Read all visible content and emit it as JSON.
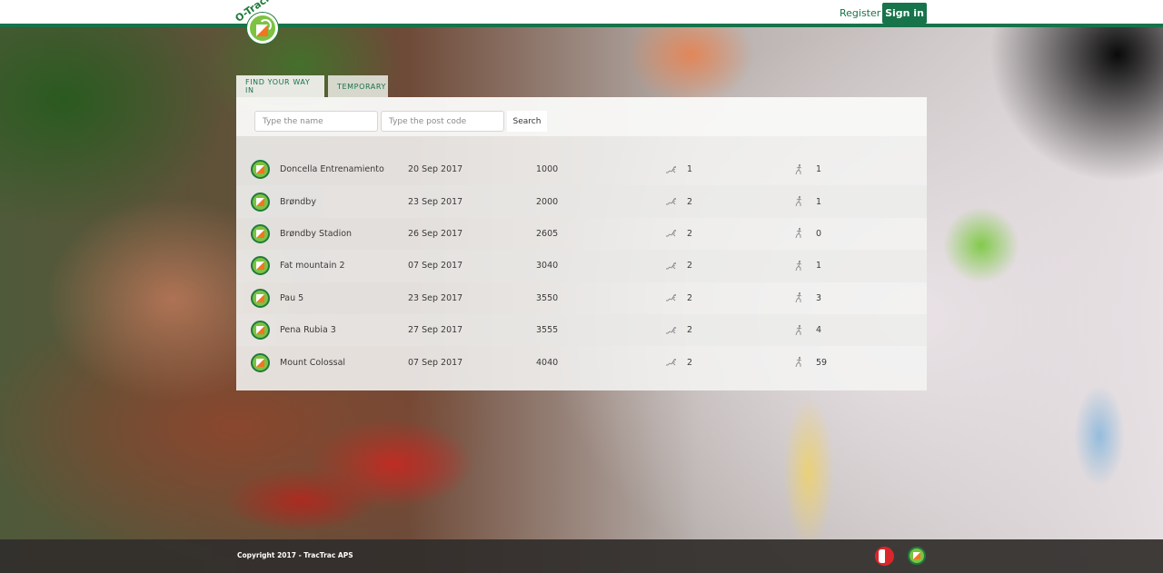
{
  "header": {
    "logo_text": "O-Track",
    "register_label": "Register",
    "signin_label": "Sign in",
    "brand_color": "#16734a"
  },
  "tabs": [
    {
      "label": "FIND YOUR WAY IN",
      "active": true
    },
    {
      "label": "TEMPORARY",
      "active": false
    }
  ],
  "search": {
    "name_placeholder": "Type the name",
    "name_value": "",
    "postcode_placeholder": "Type the post code",
    "postcode_value": "",
    "button_label": "Search"
  },
  "events": [
    {
      "icon": "orienteering-flag-icon",
      "name": "Doncella Entrenamiento",
      "date": "20 Sep 2017",
      "code": "1000",
      "runner_icon": "runner-icon",
      "count1": "1",
      "walker_icon": "walker-icon",
      "count2": "1"
    },
    {
      "icon": "orienteering-flag-icon",
      "name": "Brøndby",
      "date": "23 Sep 2017",
      "code": "2000",
      "runner_icon": "runner-icon",
      "count1": "2",
      "walker_icon": "walker-icon",
      "count2": "1"
    },
    {
      "icon": "orienteering-flag-icon",
      "name": "Brøndby Stadion",
      "date": "26 Sep 2017",
      "code": "2605",
      "runner_icon": "runner-icon",
      "count1": "2",
      "walker_icon": "walker-icon",
      "count2": "0"
    },
    {
      "icon": "orienteering-flag-icon",
      "name": "Fat mountain 2",
      "date": "07 Sep 2017",
      "code": "3040",
      "runner_icon": "runner-icon",
      "count1": "2",
      "walker_icon": "walker-icon",
      "count2": "1"
    },
    {
      "icon": "orienteering-flag-icon",
      "name": "Pau 5",
      "date": "23 Sep 2017",
      "code": "3550",
      "runner_icon": "runner-icon",
      "count1": "2",
      "walker_icon": "walker-icon",
      "count2": "3"
    },
    {
      "icon": "orienteering-flag-icon",
      "name": "Pena Rubia 3",
      "date": "27 Sep 2017",
      "code": "3555",
      "runner_icon": "runner-icon",
      "count1": "2",
      "walker_icon": "walker-icon",
      "count2": "4"
    },
    {
      "icon": "orienteering-flag-icon",
      "name": "Mount Colossal",
      "date": "07 Sep 2017",
      "code": "4040",
      "runner_icon": "runner-icon",
      "count1": "2",
      "walker_icon": "walker-icon",
      "count2": "59"
    }
  ],
  "footer": {
    "copyright": "Copyright 2017 - TracTrac APS",
    "logos": [
      "tractrac-logo-icon",
      "o-track-logo-icon"
    ]
  }
}
